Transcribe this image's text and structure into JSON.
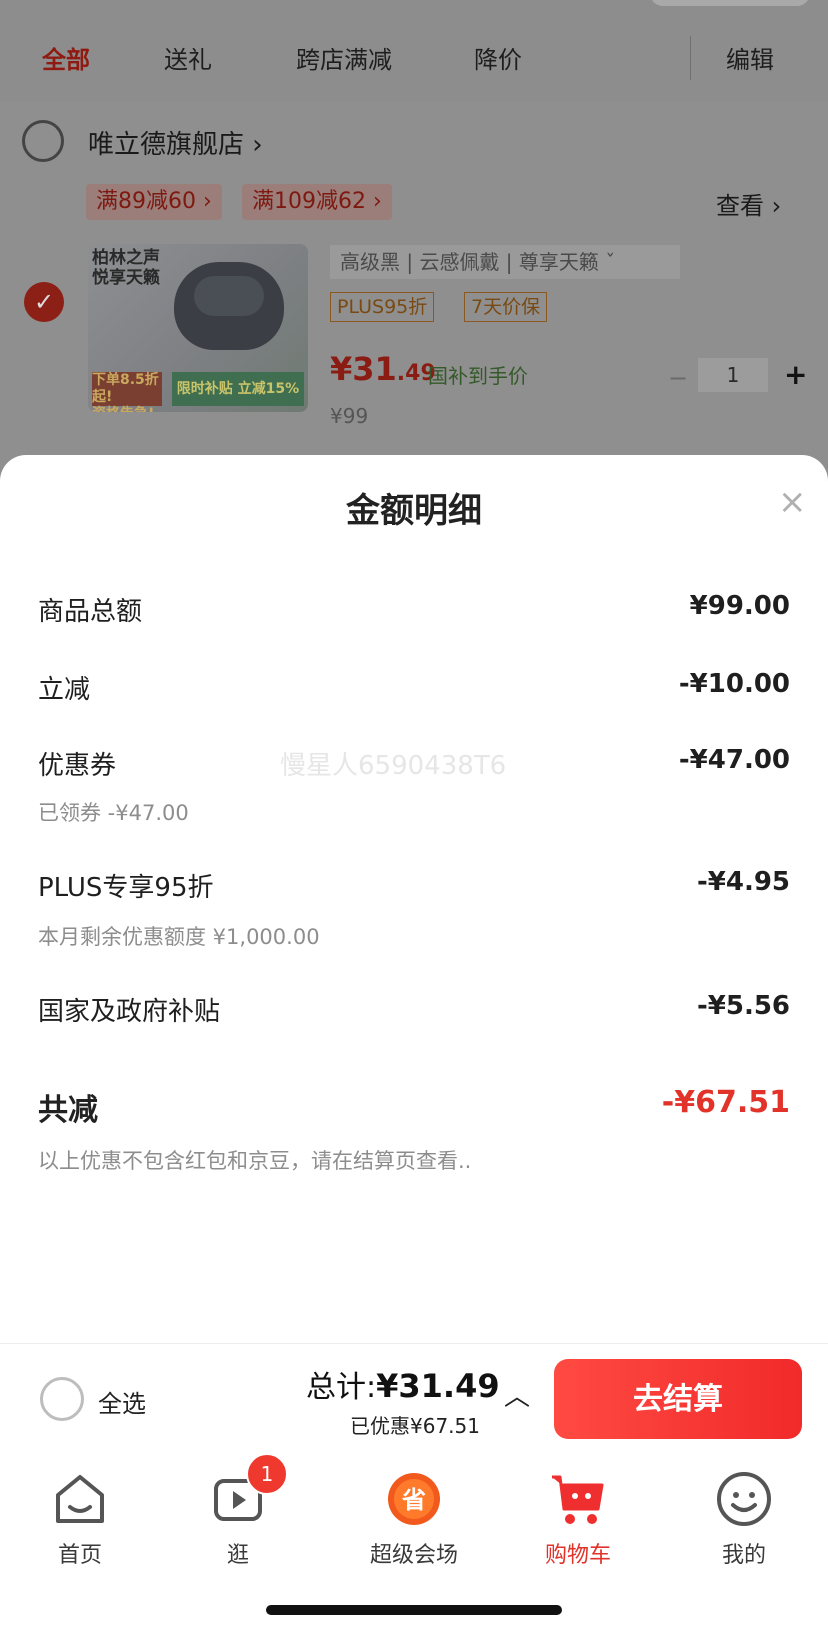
{
  "tabs": {
    "all": "全部",
    "gift": "送礼",
    "cross_store": "跨店满减",
    "price_drop": "降价",
    "edit": "编辑"
  },
  "shop": {
    "name": "唯立德旗舰店 ›",
    "promo1": "满89减60 ›",
    "promo2": "满109减62 ›",
    "view": "查看 ›"
  },
  "product": {
    "thumb_title": "柏林之声\n悦享天籁",
    "thumb_badge": "下单8.5折起!\n资格告急!",
    "thumb_promo": "限时补贴 立减15%",
    "spec": "高级黑 | 云感佩戴 | 尊享天籁  ˇ",
    "tag_plus": "PLUS95折",
    "tag_price": "7天价保",
    "price_int": "¥31",
    "price_dec": ".49",
    "price_note": "国补到手价",
    "price_old": "¥99",
    "qty": "1",
    "qty_minus": "−",
    "qty_plus": "+"
  },
  "sheet": {
    "title": "金额明细",
    "close": "×",
    "watermark": "慢星人6590438T6",
    "rows": [
      {
        "label": "商品总额",
        "value": "¥99.00",
        "sub": ""
      },
      {
        "label": "立减",
        "value": "-¥10.00",
        "sub": ""
      },
      {
        "label": "优惠券",
        "value": "-¥47.00",
        "sub": "已领券 -¥47.00"
      },
      {
        "label": "PLUS专享95折",
        "value": "-¥4.95",
        "sub": "本月剩余优惠额度 ¥1,000.00"
      },
      {
        "label": "国家及政府补贴",
        "value": "-¥5.56",
        "sub": ""
      }
    ],
    "total_label": "共减",
    "total_value": "-¥67.51",
    "footnote": "以上优惠不包含红包和京豆，请在结算页查看.."
  },
  "bottom": {
    "select_all": "全选",
    "total_prefix": "总计:",
    "total_value": "¥31.49",
    "saved": "已优惠¥67.51",
    "caret": "︿",
    "checkout": "去结算"
  },
  "nav": {
    "items": [
      {
        "label": "首页",
        "icon": "home-icon"
      },
      {
        "label": "逛",
        "icon": "video-icon",
        "badge": "1"
      },
      {
        "label": "超级会场",
        "icon": "mega-sale-icon"
      },
      {
        "label": "购物车",
        "icon": "cart-icon"
      },
      {
        "label": "我的",
        "icon": "profile-icon"
      }
    ]
  },
  "colors": {
    "accent": "#e2332a",
    "checkout_gradient_start": "#ff4a42",
    "checkout_gradient_end": "#f12a2a"
  }
}
